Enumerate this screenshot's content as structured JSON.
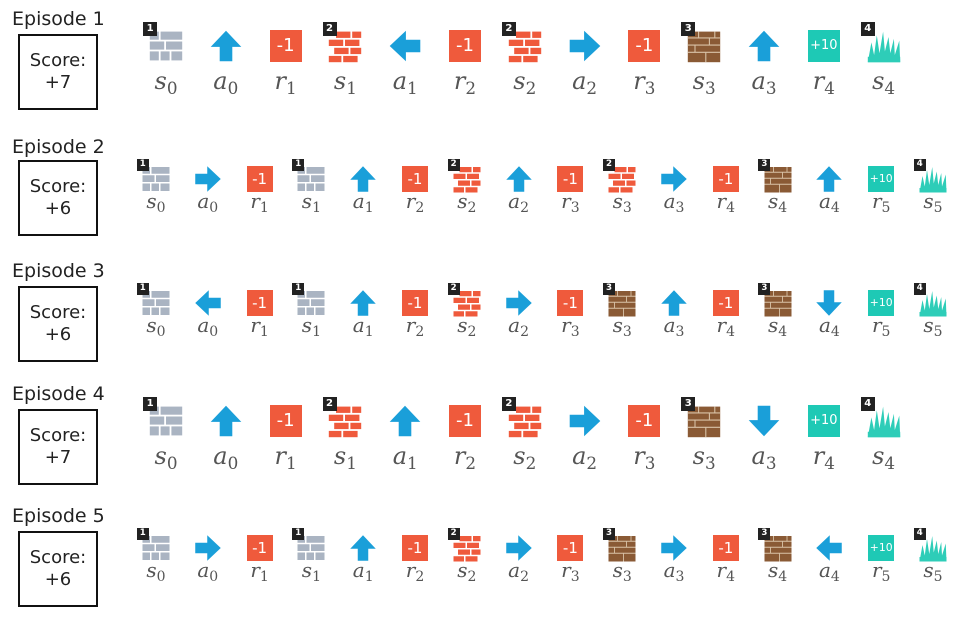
{
  "colors": {
    "arrow": "#1a9fd9",
    "neg_reward": "#ef5a3c",
    "pos_reward": "#1ec9b5",
    "red_brick": "#ef5a3c",
    "brown_brick": "#8a5a35",
    "gray_tile": "#aab4c2",
    "grass": "#2ecdb8"
  },
  "episodes": [
    {
      "title": "Episode 1",
      "score_label": "Score:",
      "score_value": "+7",
      "steps": [
        {
          "kind": "state",
          "tile": "gray",
          "badge": "1",
          "sym": "s",
          "sub": "0"
        },
        {
          "kind": "action",
          "dir": "up",
          "sym": "a",
          "sub": "0"
        },
        {
          "kind": "reward",
          "value": "-1",
          "sym": "r",
          "sub": "1"
        },
        {
          "kind": "state",
          "tile": "red",
          "badge": "2",
          "sym": "s",
          "sub": "1"
        },
        {
          "kind": "action",
          "dir": "left",
          "sym": "a",
          "sub": "1"
        },
        {
          "kind": "reward",
          "value": "-1",
          "sym": "r",
          "sub": "2"
        },
        {
          "kind": "state",
          "tile": "red",
          "badge": "2",
          "sym": "s",
          "sub": "2"
        },
        {
          "kind": "action",
          "dir": "right",
          "sym": "a",
          "sub": "2"
        },
        {
          "kind": "reward",
          "value": "-1",
          "sym": "r",
          "sub": "3"
        },
        {
          "kind": "state",
          "tile": "brown",
          "badge": "3",
          "sym": "s",
          "sub": "3"
        },
        {
          "kind": "action",
          "dir": "up",
          "sym": "a",
          "sub": "3"
        },
        {
          "kind": "reward",
          "value": "+10",
          "sym": "r",
          "sub": "4"
        },
        {
          "kind": "state",
          "tile": "grass",
          "badge": "4",
          "sym": "s",
          "sub": "4"
        }
      ]
    },
    {
      "title": "Episode 2",
      "score_label": "Score:",
      "score_value": "+6",
      "steps": [
        {
          "kind": "state",
          "tile": "gray",
          "badge": "1",
          "sym": "s",
          "sub": "0"
        },
        {
          "kind": "action",
          "dir": "right",
          "sym": "a",
          "sub": "0"
        },
        {
          "kind": "reward",
          "value": "-1",
          "sym": "r",
          "sub": "1"
        },
        {
          "kind": "state",
          "tile": "gray",
          "badge": "1",
          "sym": "s",
          "sub": "1"
        },
        {
          "kind": "action",
          "dir": "up",
          "sym": "a",
          "sub": "1"
        },
        {
          "kind": "reward",
          "value": "-1",
          "sym": "r",
          "sub": "2"
        },
        {
          "kind": "state",
          "tile": "red",
          "badge": "2",
          "sym": "s",
          "sub": "2"
        },
        {
          "kind": "action",
          "dir": "up",
          "sym": "a",
          "sub": "2"
        },
        {
          "kind": "reward",
          "value": "-1",
          "sym": "r",
          "sub": "3"
        },
        {
          "kind": "state",
          "tile": "red",
          "badge": "2",
          "sym": "s",
          "sub": "3"
        },
        {
          "kind": "action",
          "dir": "right",
          "sym": "a",
          "sub": "3"
        },
        {
          "kind": "reward",
          "value": "-1",
          "sym": "r",
          "sub": "4"
        },
        {
          "kind": "state",
          "tile": "brown",
          "badge": "3",
          "sym": "s",
          "sub": "4"
        },
        {
          "kind": "action",
          "dir": "up",
          "sym": "a",
          "sub": "4"
        },
        {
          "kind": "reward",
          "value": "+10",
          "sym": "r",
          "sub": "5"
        },
        {
          "kind": "state",
          "tile": "grass",
          "badge": "4",
          "sym": "s",
          "sub": "5"
        }
      ]
    },
    {
      "title": "Episode 3",
      "score_label": "Score:",
      "score_value": "+6",
      "steps": [
        {
          "kind": "state",
          "tile": "gray",
          "badge": "1",
          "sym": "s",
          "sub": "0"
        },
        {
          "kind": "action",
          "dir": "left",
          "sym": "a",
          "sub": "0"
        },
        {
          "kind": "reward",
          "value": "-1",
          "sym": "r",
          "sub": "1"
        },
        {
          "kind": "state",
          "tile": "gray",
          "badge": "1",
          "sym": "s",
          "sub": "1"
        },
        {
          "kind": "action",
          "dir": "up",
          "sym": "a",
          "sub": "1"
        },
        {
          "kind": "reward",
          "value": "-1",
          "sym": "r",
          "sub": "2"
        },
        {
          "kind": "state",
          "tile": "red",
          "badge": "2",
          "sym": "s",
          "sub": "2"
        },
        {
          "kind": "action",
          "dir": "right",
          "sym": "a",
          "sub": "2"
        },
        {
          "kind": "reward",
          "value": "-1",
          "sym": "r",
          "sub": "3"
        },
        {
          "kind": "state",
          "tile": "brown",
          "badge": "3",
          "sym": "s",
          "sub": "3"
        },
        {
          "kind": "action",
          "dir": "up",
          "sym": "a",
          "sub": "3"
        },
        {
          "kind": "reward",
          "value": "-1",
          "sym": "r",
          "sub": "4"
        },
        {
          "kind": "state",
          "tile": "brown",
          "badge": "3",
          "sym": "s",
          "sub": "4"
        },
        {
          "kind": "action",
          "dir": "down",
          "sym": "a",
          "sub": "4"
        },
        {
          "kind": "reward",
          "value": "+10",
          "sym": "r",
          "sub": "5"
        },
        {
          "kind": "state",
          "tile": "grass",
          "badge": "4",
          "sym": "s",
          "sub": "5"
        }
      ]
    },
    {
      "title": "Episode 4",
      "score_label": "Score:",
      "score_value": "+7",
      "steps": [
        {
          "kind": "state",
          "tile": "gray",
          "badge": "1",
          "sym": "s",
          "sub": "0"
        },
        {
          "kind": "action",
          "dir": "up",
          "sym": "a",
          "sub": "0"
        },
        {
          "kind": "reward",
          "value": "-1",
          "sym": "r",
          "sub": "1"
        },
        {
          "kind": "state",
          "tile": "red",
          "badge": "2",
          "sym": "s",
          "sub": "1"
        },
        {
          "kind": "action",
          "dir": "up",
          "sym": "a",
          "sub": "1"
        },
        {
          "kind": "reward",
          "value": "-1",
          "sym": "r",
          "sub": "2"
        },
        {
          "kind": "state",
          "tile": "red",
          "badge": "2",
          "sym": "s",
          "sub": "2"
        },
        {
          "kind": "action",
          "dir": "right",
          "sym": "a",
          "sub": "2"
        },
        {
          "kind": "reward",
          "value": "-1",
          "sym": "r",
          "sub": "3"
        },
        {
          "kind": "state",
          "tile": "brown",
          "badge": "3",
          "sym": "s",
          "sub": "3"
        },
        {
          "kind": "action",
          "dir": "down",
          "sym": "a",
          "sub": "3"
        },
        {
          "kind": "reward",
          "value": "+10",
          "sym": "r",
          "sub": "4"
        },
        {
          "kind": "state",
          "tile": "grass",
          "badge": "4",
          "sym": "s",
          "sub": "4"
        }
      ]
    },
    {
      "title": "Episode 5",
      "score_label": "Score:",
      "score_value": "+6",
      "steps": [
        {
          "kind": "state",
          "tile": "gray",
          "badge": "1",
          "sym": "s",
          "sub": "0"
        },
        {
          "kind": "action",
          "dir": "right",
          "sym": "a",
          "sub": "0"
        },
        {
          "kind": "reward",
          "value": "-1",
          "sym": "r",
          "sub": "1"
        },
        {
          "kind": "state",
          "tile": "gray",
          "badge": "1",
          "sym": "s",
          "sub": "1"
        },
        {
          "kind": "action",
          "dir": "up",
          "sym": "a",
          "sub": "1"
        },
        {
          "kind": "reward",
          "value": "-1",
          "sym": "r",
          "sub": "2"
        },
        {
          "kind": "state",
          "tile": "red",
          "badge": "2",
          "sym": "s",
          "sub": "2"
        },
        {
          "kind": "action",
          "dir": "right",
          "sym": "a",
          "sub": "2"
        },
        {
          "kind": "reward",
          "value": "-1",
          "sym": "r",
          "sub": "3"
        },
        {
          "kind": "state",
          "tile": "brown",
          "badge": "3",
          "sym": "s",
          "sub": "3"
        },
        {
          "kind": "action",
          "dir": "right",
          "sym": "a",
          "sub": "3"
        },
        {
          "kind": "reward",
          "value": "-1",
          "sym": "r",
          "sub": "4"
        },
        {
          "kind": "state",
          "tile": "brown",
          "badge": "3",
          "sym": "s",
          "sub": "4"
        },
        {
          "kind": "action",
          "dir": "left",
          "sym": "a",
          "sub": "4"
        },
        {
          "kind": "reward",
          "value": "+10",
          "sym": "r",
          "sub": "5"
        },
        {
          "kind": "state",
          "tile": "grass",
          "badge": "4",
          "sym": "s",
          "sub": "5"
        }
      ]
    }
  ]
}
